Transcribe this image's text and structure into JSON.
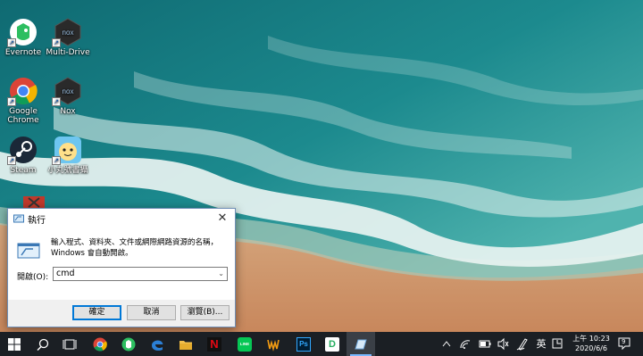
{
  "desktop": {
    "icons": [
      {
        "label": "Evernote",
        "icon": "evernote-icon"
      },
      {
        "label": "Multi-Drive",
        "icon": "nox-icon"
      },
      {
        "label": "Google Chrome",
        "icon": "chrome-icon"
      },
      {
        "label": "Nox",
        "icon": "nox-icon"
      },
      {
        "label": "Steam",
        "icon": "steam-icon"
      },
      {
        "label": "小丸號書攝",
        "icon": "app-icon"
      }
    ]
  },
  "run_dialog": {
    "title": "執行",
    "description_line1": "輸入程式、資料夾、文件或網際網路資源的名稱，",
    "description_line2": "Windows 會自動開啟。",
    "open_label": "開啟(O):",
    "open_value": "cmd",
    "ok_label": "確定",
    "cancel_label": "取消",
    "browse_label": "瀏覽(B)...",
    "close_glyph": "✕"
  },
  "taskbar": {
    "pinned": [
      {
        "name": "start",
        "icon": "windows-icon"
      },
      {
        "name": "search",
        "icon": "search-icon"
      },
      {
        "name": "task-view",
        "icon": "task-view-icon"
      },
      {
        "name": "chrome",
        "icon": "chrome-icon"
      },
      {
        "name": "evernote",
        "icon": "evernote-icon"
      },
      {
        "name": "edge",
        "icon": "edge-icon"
      },
      {
        "name": "file-explorer",
        "icon": "folder-icon"
      },
      {
        "name": "netflix",
        "icon": "netflix-icon"
      },
      {
        "name": "line",
        "icon": "line-icon"
      },
      {
        "name": "winamp",
        "icon": "winamp-icon"
      },
      {
        "name": "photoshop",
        "icon": "photoshop-icon"
      },
      {
        "name": "dictionary",
        "icon": "dictionary-icon"
      },
      {
        "name": "run",
        "icon": "run-icon"
      }
    ],
    "photoshop_text": "Ps",
    "netflix_text": "N",
    "line_text": "LINE",
    "dict_text": "D",
    "tray": {
      "ime": "英",
      "time": "上午 10:23",
      "date": "2020/6/6",
      "notification_count": "9"
    }
  },
  "colors": {
    "taskbar_bg": "#1b1f24",
    "accent": "#0078d7"
  }
}
